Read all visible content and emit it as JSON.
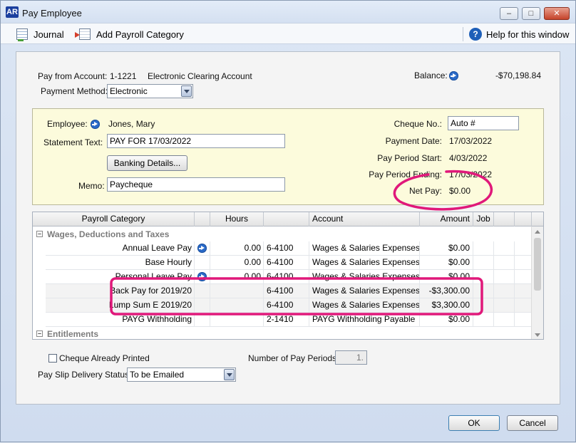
{
  "window": {
    "app_badge": "AR",
    "title": "Pay Employee",
    "minimize": "–",
    "maximize": "□",
    "close": "✕"
  },
  "toolbar": {
    "journal": "Journal",
    "add_payroll": "Add Payroll Category",
    "help": "Help for this window",
    "help_icon": "?"
  },
  "header": {
    "pay_from_label": "Pay from Account:",
    "pay_from_number": "1-1221",
    "pay_from_name": "Electronic Clearing Account",
    "balance_label": "Balance:",
    "balance_value": "-$70,198.84",
    "payment_method_label": "Payment Method:",
    "payment_method_value": "Electronic"
  },
  "employee": {
    "employee_label": "Employee:",
    "employee_value": "Jones, Mary",
    "statement_label": "Statement Text:",
    "statement_value": "PAY FOR 17/03/2022",
    "banking_button": "Banking Details...",
    "memo_label": "Memo:",
    "memo_value": "Paycheque",
    "cheque_label": "Cheque No.:",
    "cheque_value": "Auto #",
    "payment_date_label": "Payment Date:",
    "payment_date_value": "17/03/2022",
    "period_start_label": "Pay Period Start:",
    "period_start_value": "4/03/2022",
    "period_end_label": "Pay Period Ending:",
    "period_end_value": "17/03/2022",
    "net_pay_label": "Net Pay:",
    "net_pay_value": "$0.00"
  },
  "grid": {
    "columns": [
      "Payroll Category",
      "Hours",
      "Account",
      "Amount",
      "Job"
    ],
    "group_wages": "Wages, Deductions and Taxes",
    "group_entitlements": "Entitlements",
    "rows": [
      {
        "category": "Annual Leave Pay",
        "hours": "0.00",
        "acct_no": "6-4100",
        "account": "Wages & Salaries Expenses",
        "amount": "$0.00"
      },
      {
        "category": "Base Hourly",
        "hours": "0.00",
        "acct_no": "6-4100",
        "account": "Wages & Salaries Expenses",
        "amount": "$0.00"
      },
      {
        "category": "Personal Leave Pay",
        "hours": "0.00",
        "acct_no": "6-4100",
        "account": "Wages & Salaries Expenses",
        "amount": "$0.00"
      },
      {
        "category": "Back Pay for 2019/20",
        "hours": "",
        "acct_no": "6-4100",
        "account": "Wages & Salaries Expenses",
        "amount": "-$3,300.00"
      },
      {
        "category": "Lump Sum E 2019/20",
        "hours": "",
        "acct_no": "6-4100",
        "account": "Wages & Salaries Expenses",
        "amount": "$3,300.00"
      },
      {
        "category": "PAYG Withholding",
        "hours": "",
        "acct_no": "2-1410",
        "account": "PAYG Withholding Payable",
        "amount": "$0.00"
      }
    ]
  },
  "footer": {
    "cheque_printed": "Cheque Already Printed",
    "pay_periods_label": "Number of Pay Periods:",
    "pay_periods_value": "1.",
    "delivery_label": "Pay Slip Delivery Status:",
    "delivery_value": "To be Emailed",
    "ok": "OK",
    "cancel": "Cancel"
  },
  "annotation_color": "#e0187a"
}
